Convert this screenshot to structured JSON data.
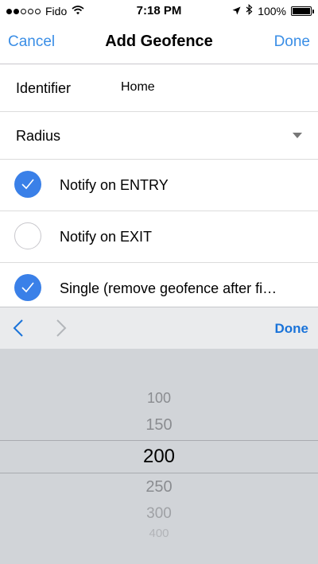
{
  "status_bar": {
    "carrier": "Fido",
    "time": "7:18 PM",
    "battery": "100%",
    "signal_bars_filled": 2,
    "signal_bars_total": 5
  },
  "nav": {
    "cancel": "Cancel",
    "title": "Add Geofence",
    "done": "Done"
  },
  "form": {
    "identifier_label": "Identifier",
    "identifier_value": "Home",
    "radius_label": "Radius",
    "options": [
      {
        "label": "Notify on ENTRY",
        "checked": true
      },
      {
        "label": "Notify on EXIT",
        "checked": false
      },
      {
        "label": "Single (remove geofence after fi…",
        "checked": true
      }
    ]
  },
  "accessory": {
    "done": "Done"
  },
  "picker": {
    "values": [
      "100",
      "150",
      "200",
      "250",
      "300",
      "400"
    ],
    "selected": "200"
  },
  "colors": {
    "accent": "#3a8ee6",
    "checkbox": "#3a80e8",
    "picker_bg": "#d1d4d8"
  }
}
